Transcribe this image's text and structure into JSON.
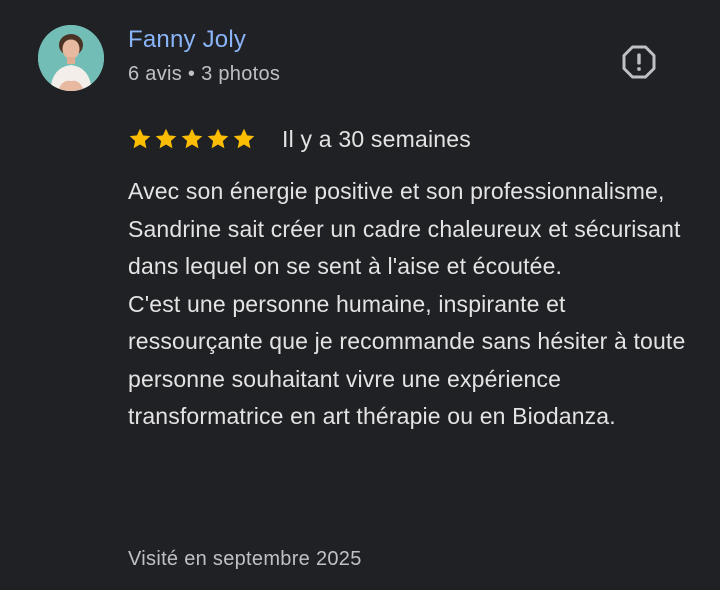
{
  "reviewer": {
    "name": "Fanny Joly",
    "reviews_count": "6 avis",
    "separator": "•",
    "photos_count": "3 photos",
    "avatar_icon": "profile-photo"
  },
  "actions": {
    "report_icon": "report-flag-icon"
  },
  "rating": {
    "stars": 5,
    "max_stars": 5,
    "star_color": "#fbbc04",
    "date": "Il y a 30 semaines"
  },
  "review": {
    "text": "Avec son énergie positive et son professionnalisme, Sandrine sait créer un cadre chaleureux et sécurisant dans lequel on se sent à l'aise et écoutée.\nC'est une personne humaine, inspirante et ressourçante que je recommande sans hésiter à toute personne souhaitant vivre une expérience transformatrice en art thérapie ou en Biodanza."
  },
  "visit": {
    "text": "Visité en septembre 2025"
  },
  "colors": {
    "background": "#202124",
    "name": "#8ab4f8",
    "text": "#e3e3e3",
    "secondary": "#bdc1c6"
  }
}
